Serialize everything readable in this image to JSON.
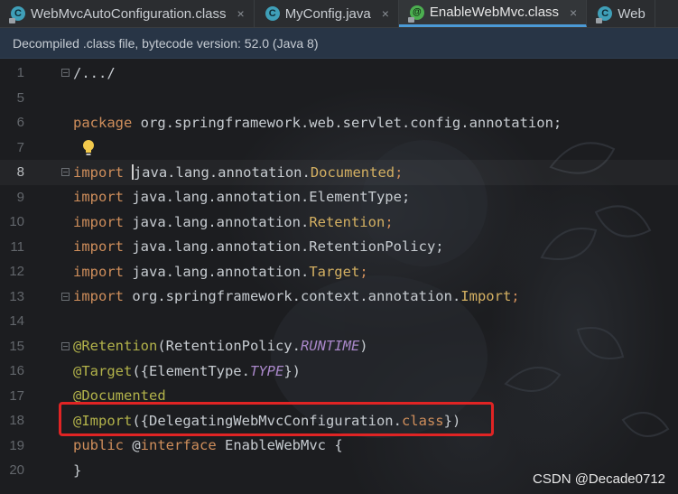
{
  "tabs": [
    {
      "label": "WebMvcAutoConfiguration.class",
      "icon": "class-icon",
      "active": false
    },
    {
      "label": "MyConfig.java",
      "icon": "class-icon",
      "active": false
    },
    {
      "label": "EnableWebMvc.class",
      "icon": "annotation-icon",
      "active": true
    },
    {
      "label": "Web",
      "icon": "class-icon",
      "active": false
    }
  ],
  "tab_close_glyph": "×",
  "banner": {
    "text": "Decompiled .class file, bytecode version: 52.0 (Java 8)"
  },
  "editor": {
    "line_numbers": [
      "1",
      "5",
      "6",
      "7",
      "8",
      "9",
      "10",
      "11",
      "12",
      "13",
      "14",
      "15",
      "16",
      "17",
      "18",
      "19",
      "20"
    ],
    "current_line": "8",
    "lines": {
      "l1": "/.../",
      "l6_kw": "package",
      "l6_rest": " org.springframework.web.servlet.config.annotation;",
      "l8_kw": "import",
      "l8_pkg": "java.lang.annotation.",
      "l8_type": "Documented",
      "l9_kw": "import",
      "l9_rest": " java.lang.annotation.ElementType;",
      "l10_kw": "import",
      "l10_pkg": " java.lang.annotation.",
      "l10_type": "Retention",
      "l11_kw": "import",
      "l11_rest": " java.lang.annotation.RetentionPolicy;",
      "l12_kw": "import",
      "l12_pkg": " java.lang.annotation.",
      "l12_type": "Target",
      "l13_kw": "import",
      "l13_pkg": " org.springframework.context.annotation.",
      "l13_type": "Import",
      "l15_anno": "@Retention",
      "l15_open": "(RetentionPolicy.",
      "l15_const": "RUNTIME",
      "l15_close": ")",
      "l16_anno": "@Target",
      "l16_open": "({ElementType.",
      "l16_const": "TYPE",
      "l16_close": "})",
      "l17_anno": "@Documented",
      "l18_anno": "@Import",
      "l18_open": "({DelegatingWebMvcConfiguration.",
      "l18_kw": "class",
      "l18_close": "})",
      "l19_kw": "public",
      "l19_at": " @",
      "l19_iface": "interface",
      "l19_rest": " EnableWebMvc {",
      "l20": "}"
    },
    "semicolon": ";"
  },
  "watermark": "CSDN @Decade0712",
  "colors": {
    "keyword": "#cf8e5b",
    "annotation": "#b2b24a",
    "constant": "#a987c9",
    "highlight_box": "#e02424",
    "banner_bg": "#283546"
  }
}
